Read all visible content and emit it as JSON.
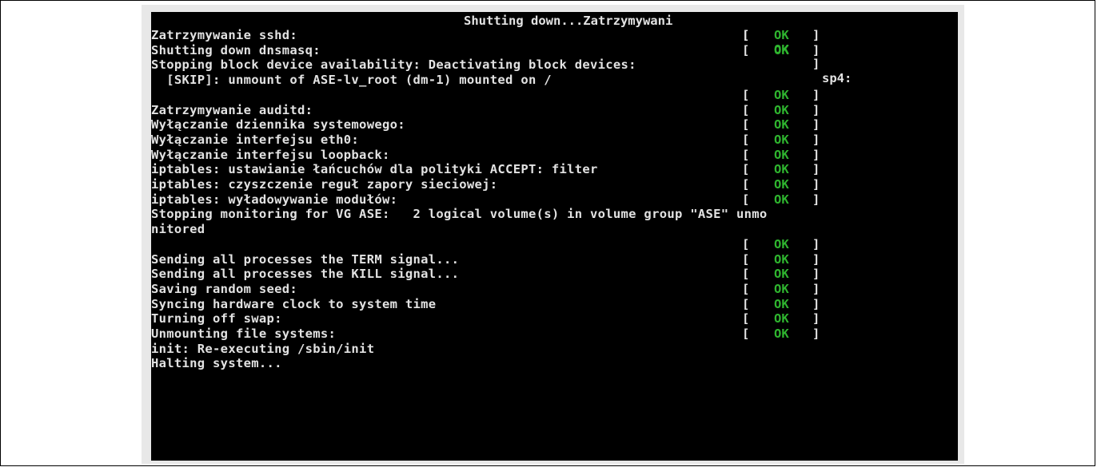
{
  "header": {
    "text": "Shutting down...Zatrzymywani",
    "suffix": "sp4:"
  },
  "status_label": "OK",
  "lines": [
    {
      "text": "Zatrzymywanie sshd:",
      "ok": true
    },
    {
      "text": "Shutting down dnsmasq:",
      "ok": true
    },
    {
      "text": "Stopping block device availability: Deactivating block devices:",
      "ok": false
    },
    {
      "text": "  [SKIP]: unmount of ASE-lv_root (dm-1) mounted on /",
      "ok": false
    },
    {
      "text": "",
      "ok": true
    },
    {
      "text": "Zatrzymywanie auditd:",
      "ok": true
    },
    {
      "text": "Wyłączanie dziennika systemowego:",
      "ok": true
    },
    {
      "text": "Wyłączanie interfejsu eth0:",
      "ok": true
    },
    {
      "text": "Wyłączanie interfejsu loopback:",
      "ok": true
    },
    {
      "text": "iptables: ustawianie łańcuchów dla polityki ACCEPT: filter",
      "ok": true
    },
    {
      "text": "iptables: czyszczenie reguł zapory sieciowej:",
      "ok": true
    },
    {
      "text": "iptables: wyładowywanie modułów:",
      "ok": true
    },
    {
      "text": "Stopping monitoring for VG ASE:   2 logical volume(s) in volume group \"ASE\" unmo",
      "ok": false
    },
    {
      "text": "nitored",
      "ok": false
    },
    {
      "text": "",
      "ok": true
    },
    {
      "text": "Sending all processes the TERM signal...",
      "ok": true
    },
    {
      "text": "Sending all processes the KILL signal...",
      "ok": true
    },
    {
      "text": "Saving random seed:",
      "ok": true
    },
    {
      "text": "Syncing hardware clock to system time",
      "ok": true
    },
    {
      "text": "Turning off swap:",
      "ok": true
    },
    {
      "text": "Unmounting file systems:",
      "ok": true
    },
    {
      "text": "init: Re-executing /sbin/init",
      "ok": false
    },
    {
      "text": "Halting system...",
      "ok": false
    }
  ]
}
